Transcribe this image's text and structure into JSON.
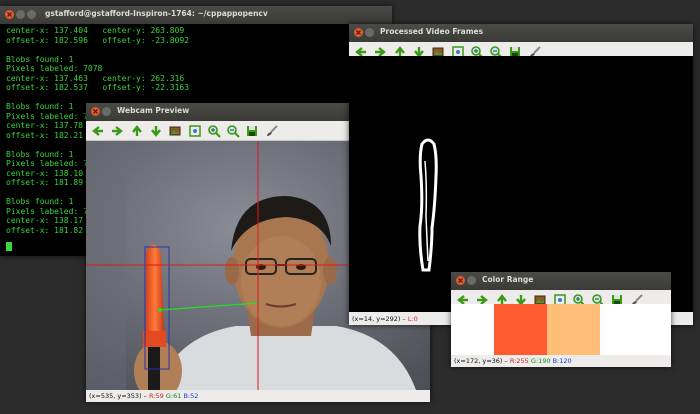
{
  "terminal": {
    "title": "gstafford@gstafford-Inspiron-1764: ~/cppappopencv",
    "lines": [
      "center-x: 137.404   center-y: 263.809",
      "offset-x: 182.596   offset-y: -23.8092",
      "",
      "Blobs found: 1",
      "Pixels labeled: 7078",
      "center-x: 137.463   center-y: 262.316",
      "offset-x: 182.537   offset-y: -22.3163",
      "",
      "Blobs found: 1",
      "Pixels labeled: 7",
      "center-x: 137.78",
      "offset-x: 182.21",
      "",
      "Blobs found: 1",
      "Pixels labeled: 7",
      "center-x: 138.10",
      "offset-x: 181.89",
      "",
      "Blobs found: 1",
      "Pixels labeled: 7",
      "center-x: 138.17",
      "offset-x: 181.82"
    ]
  },
  "webcam": {
    "title": "Webcam Preview",
    "status": {
      "coords": "(x=535, y=353)",
      "r": "R:59",
      "g": "G:61",
      "b": "B:52"
    }
  },
  "processed": {
    "title": "Processed Video Frames",
    "status": {
      "coords": "(x=14, y=292)",
      "l": "L:0"
    }
  },
  "color_range": {
    "title": "Color Range",
    "swatch_low": "#ff5a30",
    "swatch_high": "#ffbe78",
    "status": {
      "coords": "(x=172, y=36)",
      "r": "R:255",
      "g": "G:190",
      "b": "B:120"
    }
  },
  "toolbar_icons": [
    "arrow-left-icon",
    "arrow-right-icon",
    "arrow-up-icon",
    "arrow-down-icon",
    "image-icon",
    "zoom-fit-icon",
    "zoom-in-icon",
    "zoom-out-icon",
    "save-icon",
    "brush-icon"
  ],
  "colors": {
    "terminal_text": "#3cd63c",
    "accent_close": "#e25a2e",
    "tool_green": "#3a9a16"
  }
}
